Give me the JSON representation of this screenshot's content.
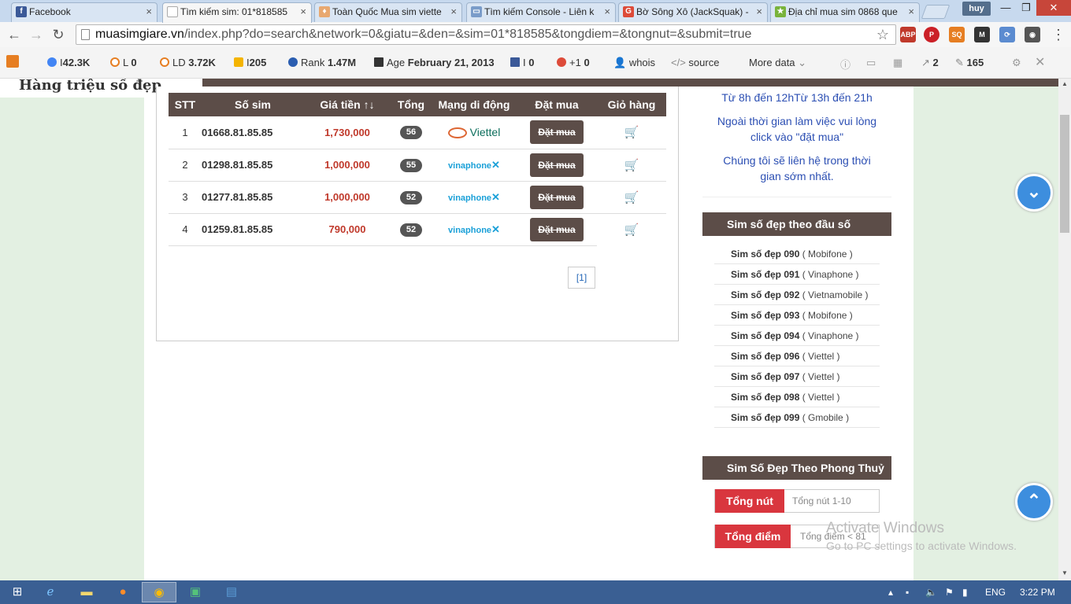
{
  "tabs": [
    {
      "title": "Facebook",
      "icon": "facebook-icon",
      "color": "#3b5998"
    },
    {
      "title": "Tìm kiếm sim: 01*818585",
      "icon": "page-icon",
      "color": "#ffffff"
    },
    {
      "title": "Toàn Quốc Mua sim viette",
      "icon": "shop-icon",
      "color": "#e8d5b0"
    },
    {
      "title": "Tìm kiếm Console - Liên k",
      "icon": "console-icon",
      "color": "#7a9cc9"
    },
    {
      "title": "Bờ Sông Xô (JackSquak) -",
      "icon": "google-plus-icon",
      "color": "#dd4b39"
    },
    {
      "title": "Địa chỉ mua sim 0868 que",
      "icon": "star-icon",
      "color": "#79b33b"
    }
  ],
  "window": {
    "user": "huy",
    "minimize": "—",
    "maximize": "❐",
    "close": "✕"
  },
  "toolbar": {
    "url_host": "muasimgiare.vn",
    "url_path": "/index.php?do=search&network=0&giatu=&den=&sim=01*818585&tongdiem=&tongnut=&submit=true",
    "extensions": [
      {
        "name": "adblock-plus",
        "label": "ABP",
        "color": "#c0392b"
      },
      {
        "name": "pinterest",
        "label": "P",
        "color": "#cb2027"
      },
      {
        "name": "seoquake",
        "label": "SQ",
        "color": "#e67e22"
      },
      {
        "name": "medium",
        "label": "M",
        "color": "#333333"
      },
      {
        "name": "sync",
        "label": "⟳",
        "color": "#5b8bd0"
      },
      {
        "name": "eye",
        "label": "◉",
        "color": "#555555"
      }
    ]
  },
  "seobar": {
    "g": "42.3K",
    "l": "0",
    "ld": "3.72K",
    "i": "205",
    "rank": "1.47M",
    "age": "February 21, 2013",
    "fb": "0",
    "gplus": "+1",
    "gplus_count": "0",
    "whois": "whois",
    "source": "source",
    "more": "More data",
    "links_out": "2",
    "links_count": "165"
  },
  "page": {
    "logo_text": "Hàng triệu số đẹp",
    "table": {
      "headers": [
        "STT",
        "Số sim",
        "Giá tiền ↑↓",
        "Tổng",
        "Mạng di động",
        "Đặt mua",
        "Giỏ hàng"
      ],
      "rows": [
        {
          "stt": "1",
          "sim": "01668.81.85.85",
          "price": "1,730,000",
          "total": "56",
          "carrier": "Viettel",
          "carrier_type": "viettel",
          "buy": "Đặt mua"
        },
        {
          "stt": "2",
          "sim": "01298.81.85.85",
          "price": "1,000,000",
          "total": "55",
          "carrier": "vinaphone",
          "carrier_type": "vinaphone",
          "buy": "Đặt mua"
        },
        {
          "stt": "3",
          "sim": "01277.81.85.85",
          "price": "1,000,000",
          "total": "52",
          "carrier": "vinaphone",
          "carrier_type": "vinaphone",
          "buy": "Đặt mua"
        },
        {
          "stt": "4",
          "sim": "01259.81.85.85",
          "price": "790,000",
          "total": "52",
          "carrier": "vinaphone",
          "carrier_type": "vinaphone",
          "buy": "Đặt mua"
        }
      ]
    },
    "pager": "[1]"
  },
  "sidebar": {
    "hours": "Từ 8h đến 12hTừ 13h đến 21h",
    "note1": "Ngoài thời gian làm việc vui lòng click vào \"đặt mua\"",
    "note2": "Chúng tôi sẽ liên hệ trong thời gian sớm nhất.",
    "prefix_title": "Sim số đẹp theo đầu số",
    "prefixes": [
      {
        "label": "Sim số đẹp 090",
        "network": "( Mobifone )"
      },
      {
        "label": "Sim số đẹp 091",
        "network": "( Vinaphone )"
      },
      {
        "label": "Sim số đẹp 092",
        "network": "( Vietnamobile )"
      },
      {
        "label": "Sim số đẹp 093",
        "network": "( Mobifone )"
      },
      {
        "label": "Sim số đẹp 094",
        "network": "( Vinaphone )"
      },
      {
        "label": "Sim số đẹp 096",
        "network": "( Viettel )"
      },
      {
        "label": "Sim số đẹp 097",
        "network": "( Viettel )"
      },
      {
        "label": "Sim số đẹp 098",
        "network": "( Viettel )"
      },
      {
        "label": "Sim số đẹp 099",
        "network": "( Gmobile )"
      }
    ],
    "phongthuy_title": "Sim Số Đẹp Theo Phong Thuỷ",
    "tong_nut_label": "Tổng nút",
    "tong_nut_value": "Tổng nút 1-10",
    "tong_diem_label": "Tổng điểm",
    "tong_diem_value": "Tổng điểm < 81"
  },
  "watermark": {
    "line1": "Activate Windows",
    "line2": "Go to PC settings to activate Windows."
  },
  "taskbar": {
    "lang": "ENG",
    "time": "3:22 PM"
  }
}
